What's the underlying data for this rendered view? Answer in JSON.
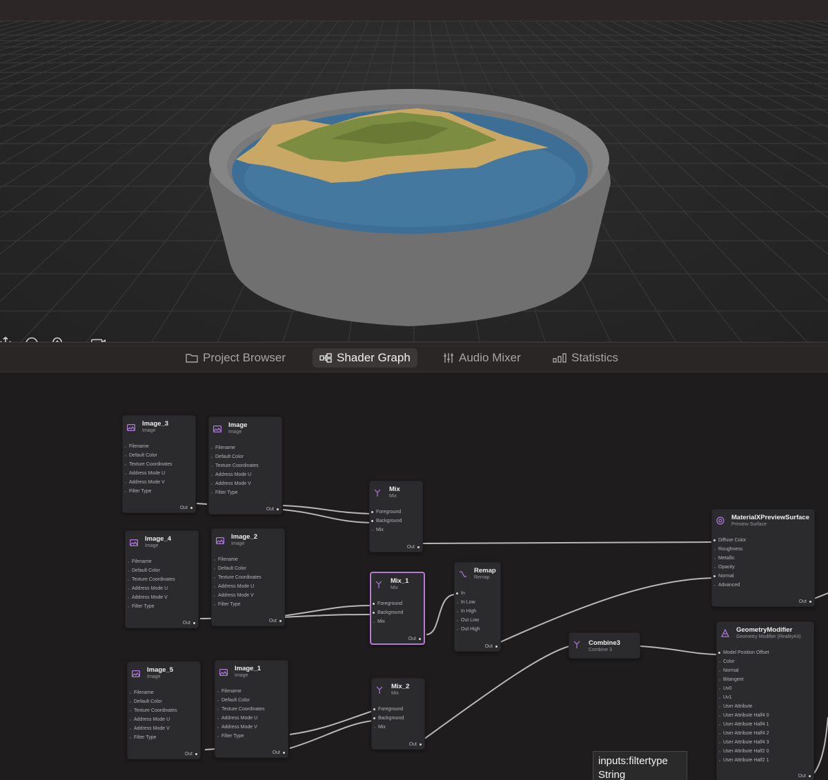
{
  "tabs": [
    {
      "label": "Project Browser",
      "icon": "folder-icon"
    },
    {
      "label": "Shader Graph",
      "icon": "node-graph-icon",
      "active": true
    },
    {
      "label": "Audio Mixer",
      "icon": "sliders-icon"
    },
    {
      "label": "Statistics",
      "icon": "bar-chart-icon"
    }
  ],
  "viewport_tools": [
    {
      "name": "move-icon"
    },
    {
      "name": "orbit-icon"
    },
    {
      "name": "zoom-icon"
    },
    {
      "name": "camera-reset-icon"
    }
  ],
  "image_ports": [
    "Filename",
    "Default Color",
    "Texture Coordinates",
    "Address Mode U",
    "Address Mode V",
    "Filter Type"
  ],
  "mix_ports": [
    "Foreground",
    "Background",
    "Mix"
  ],
  "remap_ports": [
    "In",
    "In Low",
    "In High",
    "Out Low",
    "Out High"
  ],
  "surface_ports": [
    "Diffuse Color",
    "Roughness",
    "Metallic",
    "Opacity",
    "Normal",
    "Advanced"
  ],
  "geometry_ports": [
    "Model Position Offset",
    "Color",
    "Normal",
    "Bitangent",
    "Uv0",
    "Uv1",
    "User Attribute",
    "User Attribute Half4 0",
    "User Attribute Half4 1",
    "User Attribute Half4 2",
    "User Attribute Half4 3",
    "User Attribute Half2 0",
    "User Attribute Half2 1"
  ],
  "out_label": "Out",
  "nodes": {
    "image_3": {
      "title": "Image_3",
      "subtitle": "Image"
    },
    "image": {
      "title": "Image",
      "subtitle": "Image"
    },
    "image_4": {
      "title": "Image_4",
      "subtitle": "Image"
    },
    "image_2": {
      "title": "Image_2",
      "subtitle": "Image"
    },
    "image_5": {
      "title": "Image_5",
      "subtitle": "Image"
    },
    "image_1": {
      "title": "Image_1",
      "subtitle": "Image"
    },
    "mix": {
      "title": "Mix",
      "subtitle": "Mix"
    },
    "mix_1": {
      "title": "Mix_1",
      "subtitle": "Mix"
    },
    "mix_2": {
      "title": "Mix_2",
      "subtitle": "Mix"
    },
    "remap": {
      "title": "Remap",
      "subtitle": "Remap"
    },
    "combine3": {
      "title": "Combine3",
      "subtitle": "Combine 3"
    },
    "surface": {
      "title": "MaterialXPreviewSurface",
      "subtitle": "Preview Surface"
    },
    "geometry": {
      "title": "GeometryModifier",
      "subtitle": "Geometry Modifier (RealityKit)"
    }
  },
  "tooltip": {
    "line1": "inputs:filtertype",
    "line2": "String"
  }
}
